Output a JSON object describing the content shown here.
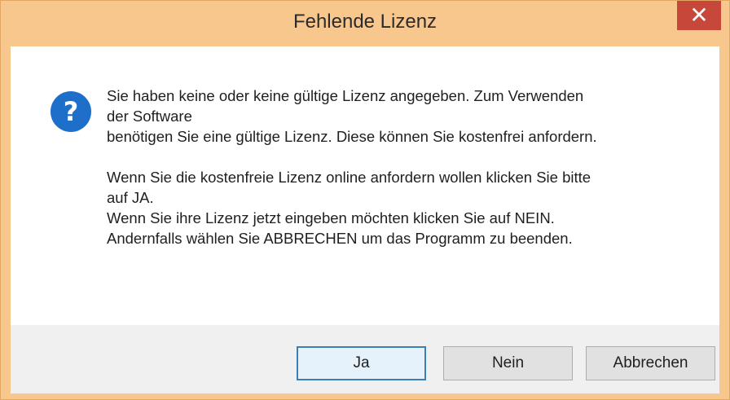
{
  "window": {
    "title": "Fehlende Lizenz",
    "close_label": "✕"
  },
  "dialog": {
    "icon": "question-icon",
    "message": {
      "line1": "Sie haben keine oder keine gültige Lizenz angegeben. Zum Verwenden",
      "line2": "der Software",
      "line3": "benötigen Sie eine gültige Lizenz. Diese können Sie kostenfrei anfordern.",
      "line4": "Wenn Sie die kostenfreie Lizenz online anfordern wollen klicken Sie bitte",
      "line5": "auf JA.",
      "line6": "Wenn Sie ihre Lizenz jetzt eingeben möchten klicken Sie auf NEIN.",
      "line7": "Andernfalls wählen Sie ABBRECHEN um das Programm zu beenden."
    }
  },
  "buttons": {
    "yes": "Ja",
    "no": "Nein",
    "cancel": "Abbrechen"
  },
  "colors": {
    "titlebar": "#f8c78e",
    "close_button": "#c7483a",
    "icon_blue": "#1e6fc9",
    "default_button_border": "#3c7fb1"
  }
}
